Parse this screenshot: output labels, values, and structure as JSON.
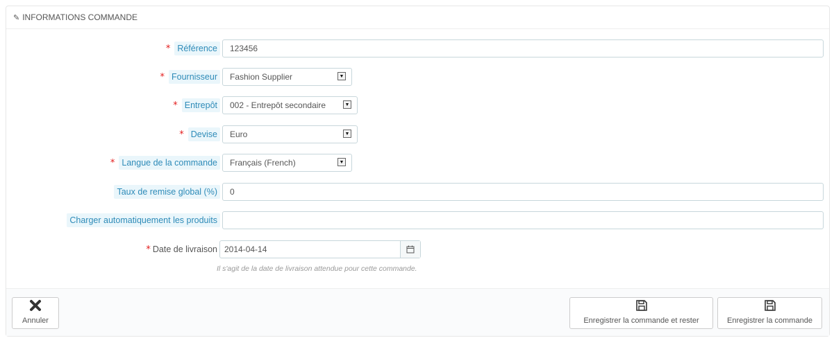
{
  "panel": {
    "title": "INFORMATIONS COMMANDE",
    "pencil_icon": "pencil-icon"
  },
  "form": {
    "required_mark": "*",
    "reference": {
      "label": "Référence",
      "value": "123456"
    },
    "supplier": {
      "label": "Fournisseur",
      "value": "Fashion Supplier"
    },
    "warehouse": {
      "label": "Entrepôt",
      "value": "002 - Entrepôt secondaire"
    },
    "currency": {
      "label": "Devise",
      "value": "Euro"
    },
    "language": {
      "label": "Langue de la commande",
      "value": "Français (French)"
    },
    "discount": {
      "label": "Taux de remise global (%)",
      "value": "0"
    },
    "autoload": {
      "label": "Charger automatiquement les produits",
      "value": ""
    },
    "delivery_date": {
      "label": "Date de livraison",
      "value": "2014-04-14",
      "help": "Il s'agit de la date de livraison attendue pour cette commande."
    }
  },
  "footer": {
    "cancel_label": "Annuler",
    "save_stay_label": "Enregistrer la commande et rester",
    "save_label": "Enregistrer la commande"
  },
  "colors": {
    "required": "#e31b1b",
    "hint_label_bg": "#eaf6fb",
    "hint_label_text": "#2e8bb8"
  }
}
